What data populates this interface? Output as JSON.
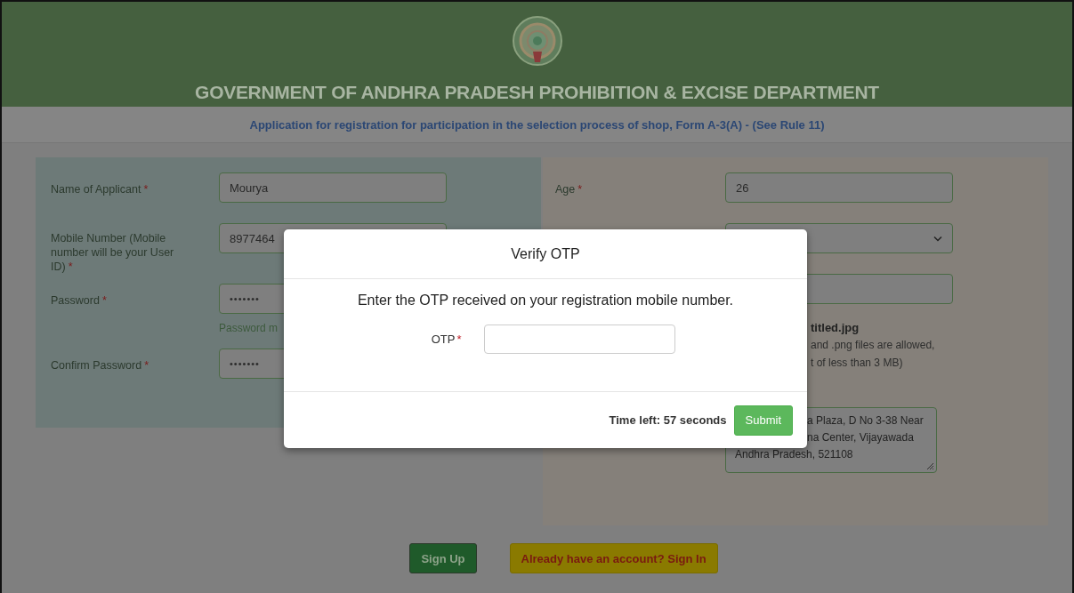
{
  "header": {
    "title": "GOVERNMENT OF ANDHRA PRADESH PROHIBITION & EXCISE DEPARTMENT",
    "subtitle": "Application for registration for participation in the selection process of shop, Form A-3(A) - (See Rule 11)"
  },
  "left_fields": [
    {
      "kind": "text",
      "label": "Name of Applicant",
      "required_mark": "*",
      "value": "Mourya"
    },
    {
      "kind": "text",
      "label": "Mobile Number (Mobile number will be your User ID)",
      "required_mark": "*",
      "value": "8977464"
    },
    {
      "kind": "password",
      "label": "Password",
      "required_mark": "*",
      "value": "•••••••",
      "hint": "Password m"
    },
    {
      "kind": "password",
      "label": "Confirm Password",
      "required_mark": "*",
      "value": "•••••••"
    }
  ],
  "right_fields": [
    {
      "kind": "text",
      "label": "Age",
      "required_mark": "*",
      "value": "26"
    },
    {
      "kind": "select"
    },
    {
      "kind": "text"
    },
    {
      "kind": "file",
      "file_name": "titled.jpg",
      "hint_lines": [
        "and .png files are allowed,",
        "t of less than 3 MB)"
      ]
    },
    {
      "kind": "textarea",
      "lines": [
        "a Plaza, D No 3-38 Near",
        "na Center, Vijayawada",
        "Andhra Pradesh, 521108"
      ]
    }
  ],
  "buttons": [
    {
      "kind": "primary",
      "label": "Sign Up"
    },
    {
      "kind": "secondary",
      "label": "Already have an account? Sign In"
    }
  ],
  "modal": {
    "title": "Verify OTP",
    "message": "Enter the OTP received on your registration mobile number.",
    "otp_label": "OTP",
    "required_mark": "*",
    "time_left": "Time left: 57 seconds",
    "submit": "Submit"
  }
}
